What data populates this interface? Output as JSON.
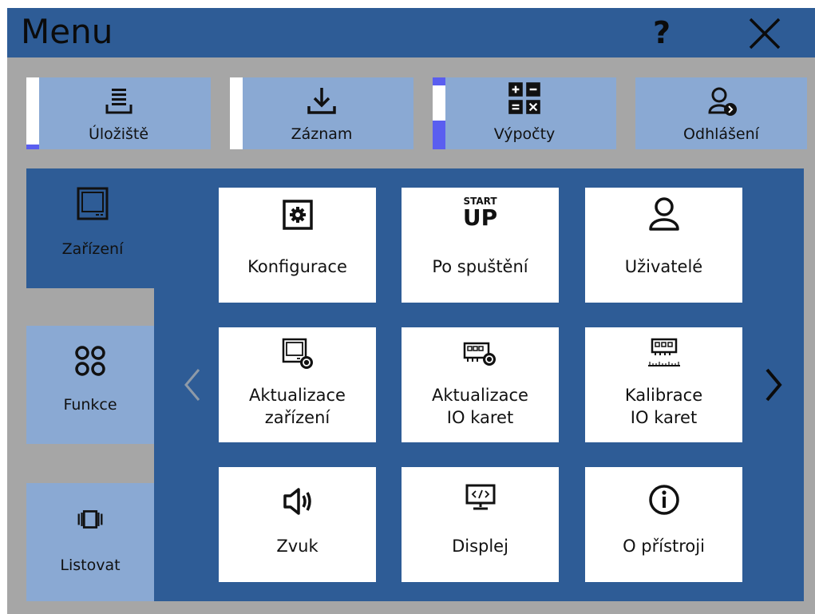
{
  "header": {
    "title": "Menu",
    "help_label": "?",
    "close_icon": "close-icon"
  },
  "top_buttons": [
    {
      "label": "Úložiště",
      "icon": "storage-icon",
      "selected": false
    },
    {
      "label": "Záznam",
      "icon": "download-icon",
      "selected": false
    },
    {
      "label": "Výpočty",
      "icon": "calculator-icon",
      "selected": true
    },
    {
      "label": "Odhlášení",
      "icon": "logout-user-icon",
      "selected": false
    }
  ],
  "side_tabs": [
    {
      "label": "Zařízení",
      "icon": "device-icon",
      "active": true
    },
    {
      "label": "Funkce",
      "icon": "functions-icon",
      "active": false
    },
    {
      "label": "Listovat",
      "icon": "browse-icon",
      "active": false
    }
  ],
  "tiles": [
    {
      "label": "Konfigurace",
      "icon": "settings-icon"
    },
    {
      "label": "Po spuštění",
      "icon": "startup-icon",
      "icon_text_top": "START",
      "icon_text_bottom": "UP"
    },
    {
      "label": "Uživatelé",
      "icon": "user-icon"
    },
    {
      "label_line1": "Aktualizace",
      "label_line2": "zařízení",
      "icon": "device-update-icon"
    },
    {
      "label_line1": "Aktualizace",
      "label_line2": "IO karet",
      "icon": "io-card-update-icon"
    },
    {
      "label_line1": "Kalibrace",
      "label_line2": "IO karet",
      "icon": "io-card-calibration-icon"
    },
    {
      "label": "Zvuk",
      "icon": "speaker-icon"
    },
    {
      "label": "Displej",
      "icon": "display-icon"
    },
    {
      "label": "O přístroji",
      "icon": "info-icon"
    }
  ],
  "nav": {
    "prev_icon": "chevron-left-icon",
    "next_icon": "chevron-right-icon"
  },
  "colors": {
    "primary_blue": "#2e5c96",
    "light_blue": "#8aa9d3",
    "frame_gray": "#a6a6a6",
    "selection_indicator": "#5a5ef0"
  }
}
